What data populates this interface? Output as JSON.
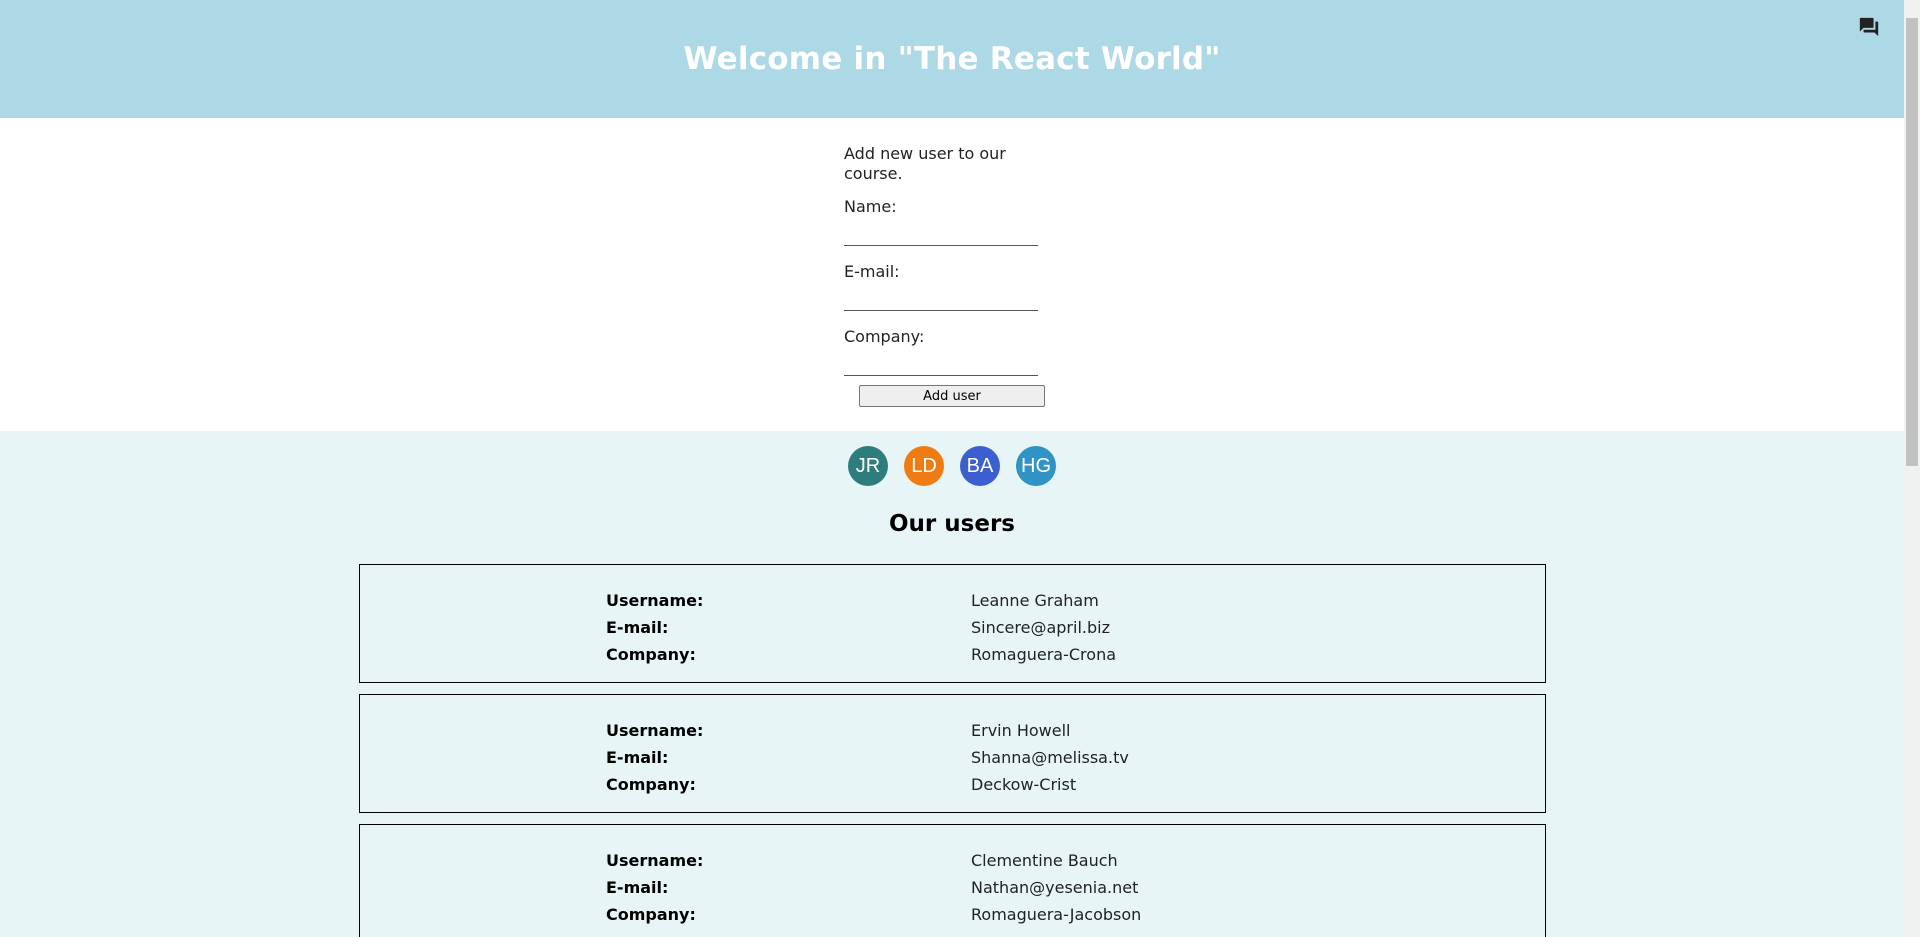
{
  "header": {
    "title": "Welcome in \"The React World\"",
    "chat_icon": "chat-bubbles-icon"
  },
  "form": {
    "intro": "Add new user to our course.",
    "name_label": "Name:",
    "name_value": "",
    "email_label": "E-mail:",
    "email_value": "",
    "company_label": "Company:",
    "company_value": "",
    "submit_label": "Add user"
  },
  "avatars": [
    {
      "initials": "JR",
      "color": "#2e7d7d"
    },
    {
      "initials": "LD",
      "color": "#ef7c13"
    },
    {
      "initials": "BA",
      "color": "#3b5fcf"
    },
    {
      "initials": "HG",
      "color": "#2f93c6"
    }
  ],
  "users_title": "Our users",
  "labels": {
    "username": "Username:",
    "email": "E-mail:",
    "company": "Company:"
  },
  "users": [
    {
      "username": "Leanne Graham",
      "email": "Sincere@april.biz",
      "company": "Romaguera-Crona"
    },
    {
      "username": "Ervin Howell",
      "email": "Shanna@melissa.tv",
      "company": "Deckow-Crist"
    },
    {
      "username": "Clementine Bauch",
      "email": "Nathan@yesenia.net",
      "company": "Romaguera-Jacobson"
    }
  ],
  "colors": {
    "header_bg": "#add8e6",
    "users_bg": "#e8f5f6"
  }
}
